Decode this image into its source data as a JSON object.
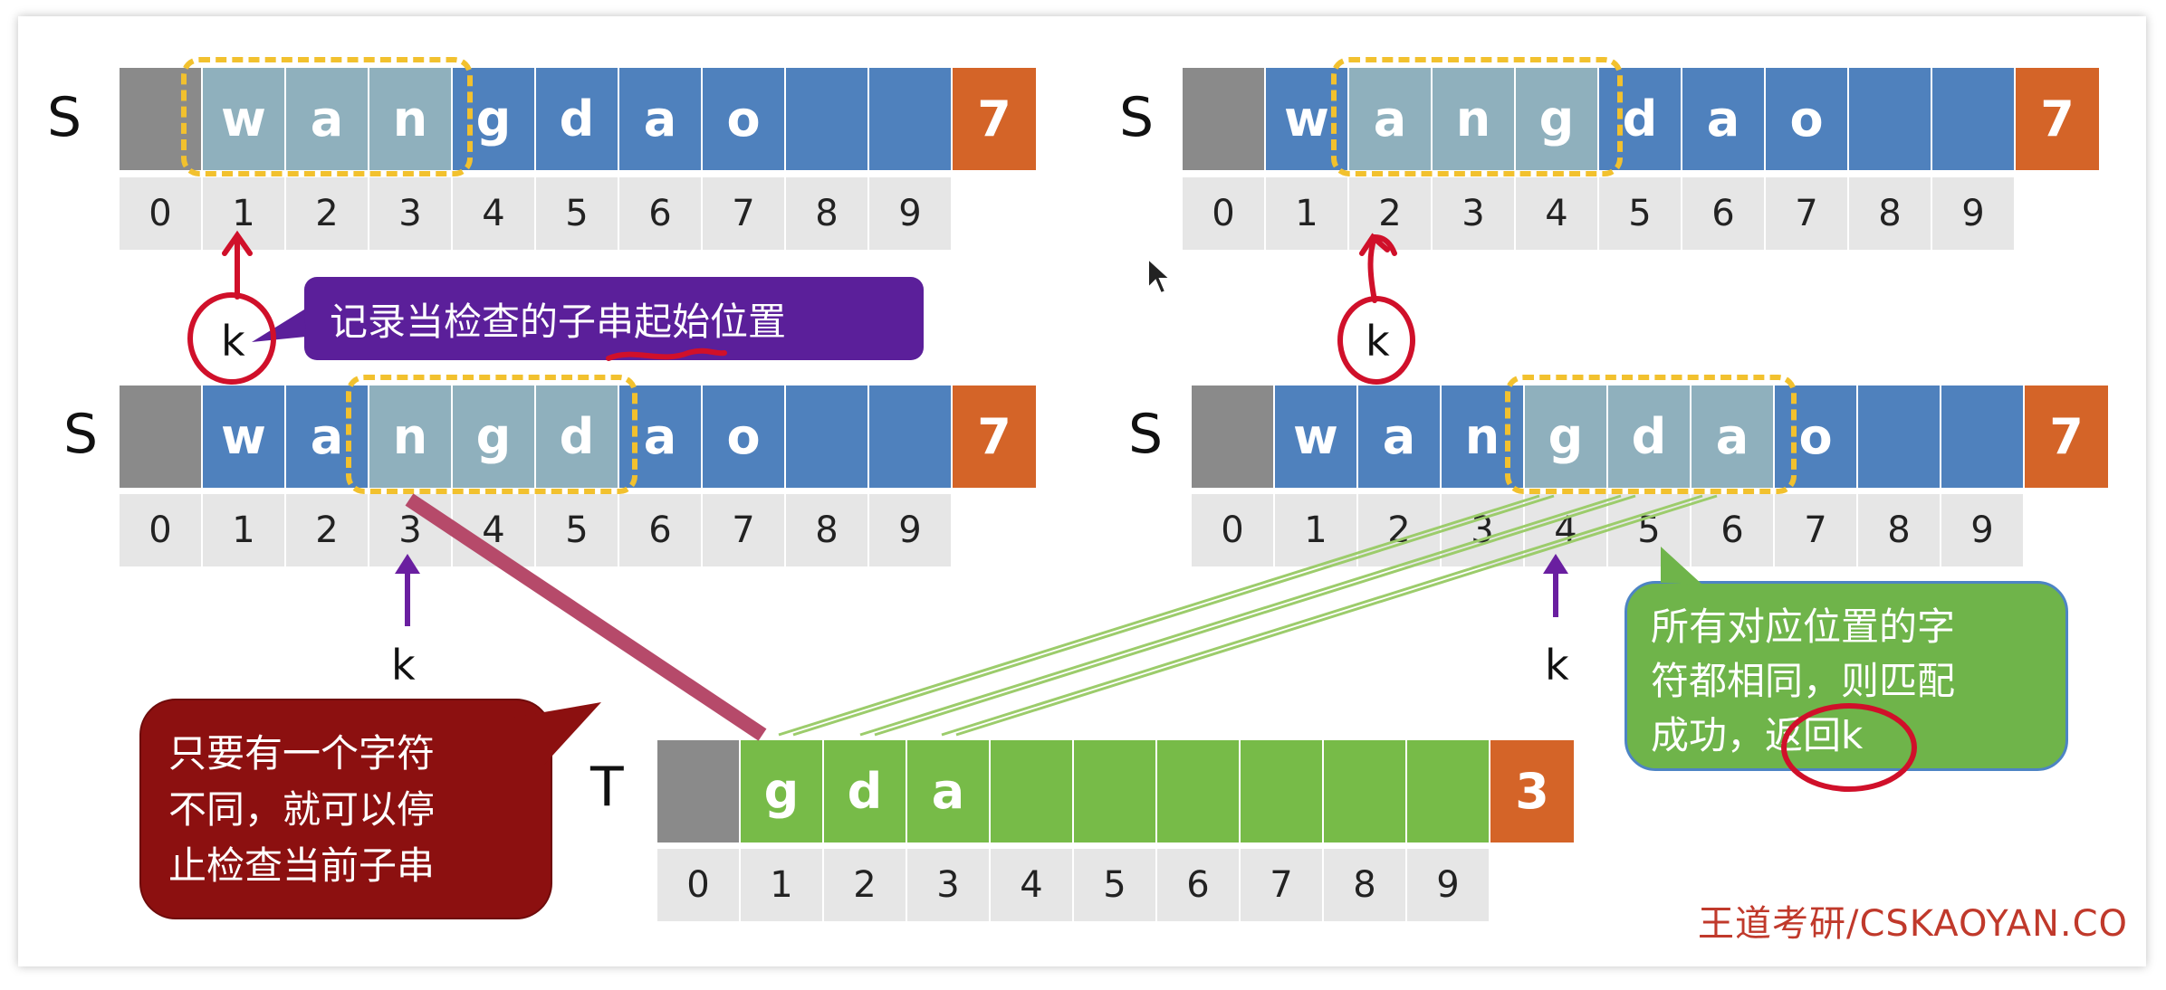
{
  "panels": {
    "top_left": {
      "label": "S",
      "chars": [
        "w",
        "a",
        "n",
        "g",
        "d",
        "a",
        "o",
        "",
        ""
      ],
      "length": "7",
      "indices": [
        "0",
        "1",
        "2",
        "3",
        "4",
        "5",
        "6",
        "7",
        "8",
        "9"
      ],
      "pointer": "k"
    },
    "top_right": {
      "label": "S",
      "chars": [
        "w",
        "a",
        "n",
        "g",
        "d",
        "a",
        "o",
        "",
        ""
      ],
      "length": "7",
      "indices": [
        "0",
        "1",
        "2",
        "3",
        "4",
        "5",
        "6",
        "7",
        "8",
        "9"
      ],
      "pointer": "k"
    },
    "mid_left": {
      "label": "S",
      "chars": [
        "w",
        "a",
        "n",
        "g",
        "d",
        "a",
        "o",
        "",
        ""
      ],
      "length": "7",
      "indices": [
        "0",
        "1",
        "2",
        "3",
        "4",
        "5",
        "6",
        "7",
        "8",
        "9"
      ],
      "pointer": "k"
    },
    "mid_right": {
      "label": "S",
      "chars": [
        "w",
        "a",
        "n",
        "g",
        "d",
        "a",
        "o",
        "",
        ""
      ],
      "length": "7",
      "indices": [
        "0",
        "1",
        "2",
        "3",
        "4",
        "5",
        "6",
        "7",
        "8",
        "9"
      ],
      "pointer": "k"
    },
    "pattern": {
      "label": "T",
      "chars": [
        "g",
        "d",
        "a",
        "",
        "",
        "",
        "",
        "",
        ""
      ],
      "length": "3",
      "indices": [
        "0",
        "1",
        "2",
        "3",
        "4",
        "5",
        "6",
        "7",
        "8",
        "9"
      ]
    }
  },
  "callouts": {
    "record_position": "记录当检查的子串起始位置",
    "stop_checking": [
      "只要有一个字符",
      "不同，就可以停",
      "止检查当前子串"
    ],
    "match_success": [
      "所有对应位置的字",
      "符都相同，则匹配"
    ],
    "match_success_prefix": "成功，",
    "match_success_return": "返回k"
  },
  "watermark": "王道考研/CSKAOYAN.CO",
  "colors": {
    "blue_cell": "#4f81bd",
    "green_cell": "#77bb48",
    "length_cell": "#d46428",
    "highlight_box": "#f2c12e",
    "purple_callout": "#5b1f9a",
    "red_callout": "#8c1010",
    "green_callout": "#6fb44a",
    "pen_red": "#d0102a"
  },
  "icons": [
    "mouse-cursor-icon"
  ]
}
